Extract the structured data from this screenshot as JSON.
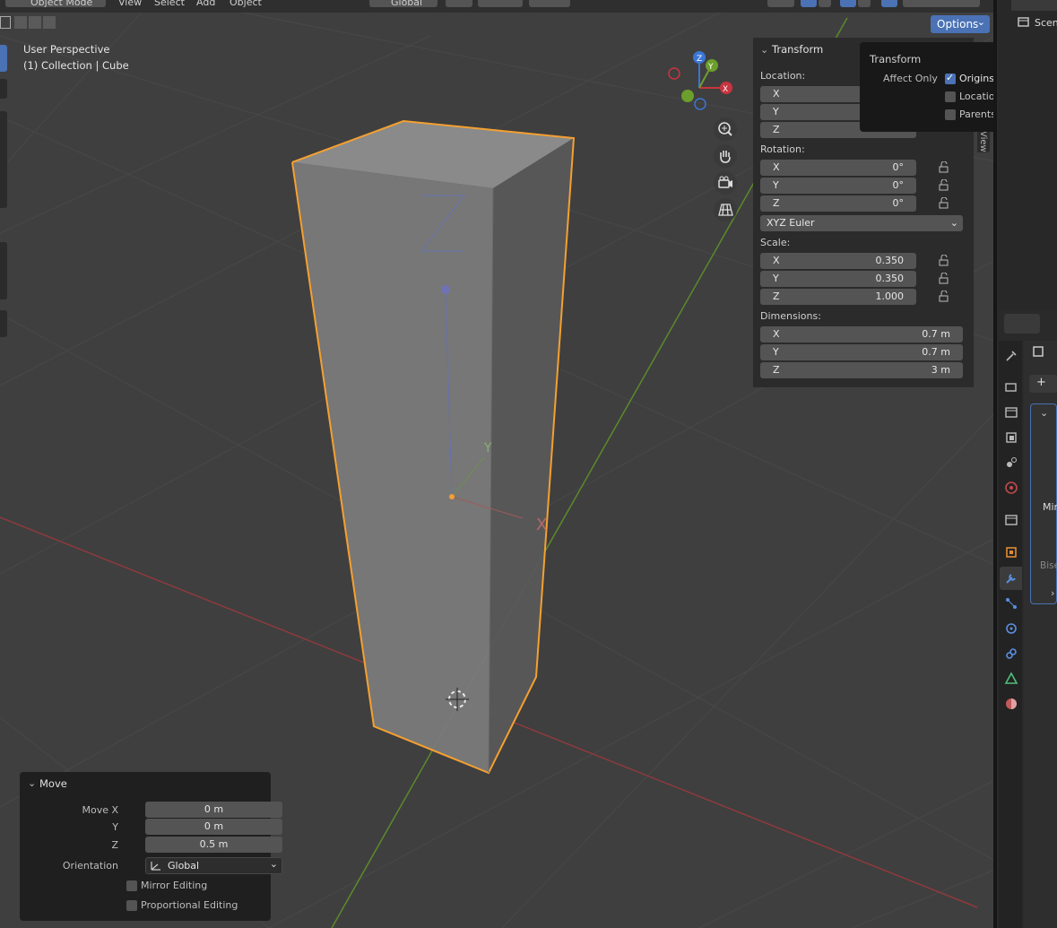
{
  "header": {
    "mode_label": "Object Mode",
    "menus": [
      "View",
      "Select",
      "Add",
      "Object"
    ],
    "orientation_label": "Global",
    "options_label": "Options"
  },
  "overlay": {
    "perspective": "User Perspective",
    "collection_path": "(1) Collection | Cube"
  },
  "gizmo": {
    "x": "X",
    "y": "Y",
    "z": "Z"
  },
  "transform_panel": {
    "title": "Transform",
    "location_label": "Location:",
    "location": [
      {
        "axis": "X",
        "value": ""
      },
      {
        "axis": "Y",
        "value": ""
      },
      {
        "axis": "Z",
        "value": ""
      }
    ],
    "rotation_label": "Rotation:",
    "rotation": [
      {
        "axis": "X",
        "value": "0°"
      },
      {
        "axis": "Y",
        "value": "0°"
      },
      {
        "axis": "Z",
        "value": "0°"
      }
    ],
    "rotation_mode": "XYZ Euler",
    "scale_label": "Scale:",
    "scale": [
      {
        "axis": "X",
        "value": "0.350"
      },
      {
        "axis": "Y",
        "value": "0.350"
      },
      {
        "axis": "Z",
        "value": "1.000"
      }
    ],
    "dimensions_label": "Dimensions:",
    "dimensions": [
      {
        "axis": "X",
        "value": "0.7 m"
      },
      {
        "axis": "Y",
        "value": "0.7 m"
      },
      {
        "axis": "Z",
        "value": "3 m"
      }
    ],
    "side_tab": "View"
  },
  "options_popover": {
    "title": "Transform",
    "affect_only_label": "Affect Only",
    "items": [
      {
        "label": "Origins",
        "checked": true
      },
      {
        "label": "Locations",
        "checked": false
      },
      {
        "label": "Parents",
        "checked": false
      }
    ]
  },
  "move_panel": {
    "title": "Move",
    "move_x_label": "Move X",
    "move_x": "0 m",
    "y_label": "Y",
    "y": "0 m",
    "z_label": "Z",
    "z": "0.5 m",
    "orientation_label": "Orientation",
    "orientation_value": "Global",
    "mirror_label": "Mirror Editing",
    "proportional_label": "Proportional Editing"
  },
  "properties": {
    "outliner_label": "Scen",
    "modifier_label": "Mir",
    "bisect_label": "Bise",
    "add_label": "+"
  },
  "colors": {
    "accent": "#4a72b5",
    "selection_outline": "#f5a030",
    "x_axis": "#c9343e",
    "y_axis": "#6c9e2c",
    "z_axis": "#3b75d6"
  }
}
